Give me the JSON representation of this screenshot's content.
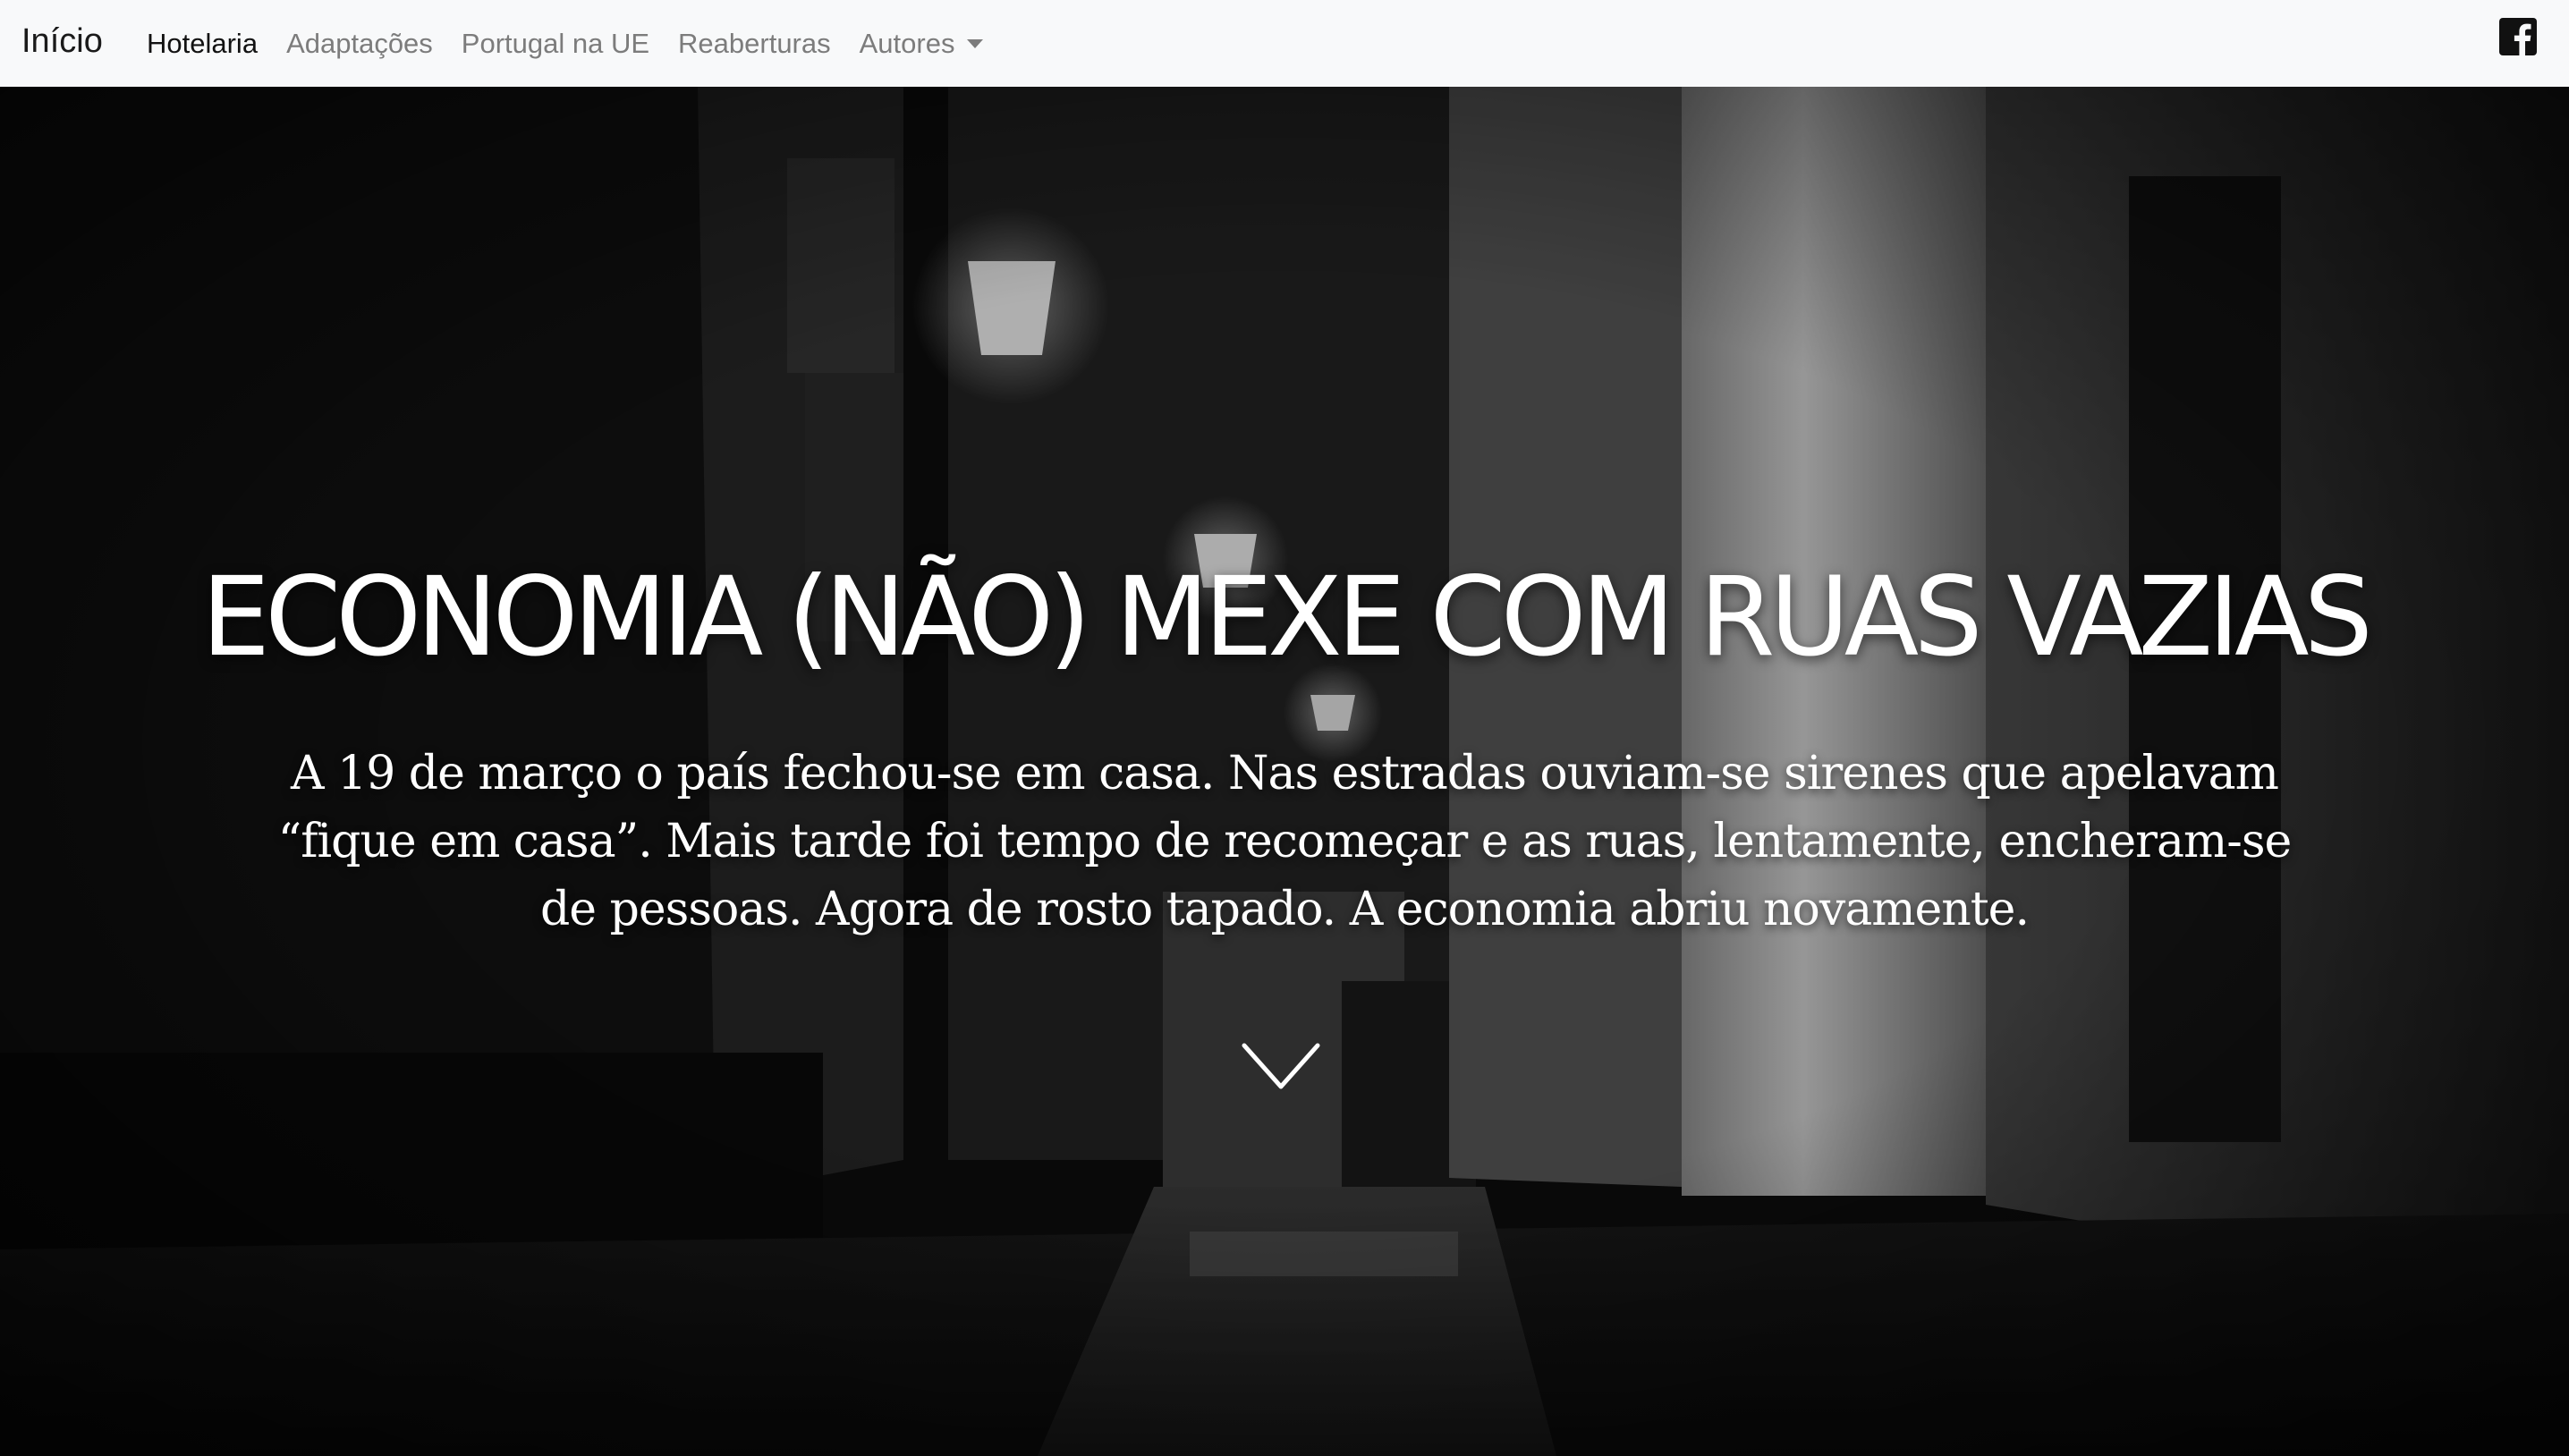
{
  "nav": {
    "brand": "Início",
    "items": [
      {
        "label": "Hotelaria",
        "active": true
      },
      {
        "label": "Adaptações"
      },
      {
        "label": "Portugal na UE"
      },
      {
        "label": "Reaberturas"
      },
      {
        "label": "Autores",
        "dropdown": true
      }
    ],
    "social_icon": "facebook-icon"
  },
  "hero": {
    "title": "ECONOMIA (NÃO) MEXE COM RUAS VAZIAS",
    "lead": "A 19 de março o país fechou-se em casa. Nas estradas ouviam-se sirenes que apelavam “fique em casa”. Mais tarde foi tempo de recomeçar e as ruas, lentamente, encheram-se de pessoas. Agora de rosto tapado. A economia abriu novamente.",
    "scroll_icon": "chevron-down-icon"
  },
  "colors": {
    "navbar_bg": "#f8f9fa",
    "nav_text": "#7c7c7c",
    "nav_active": "#121212",
    "hero_text": "#ffffff"
  }
}
